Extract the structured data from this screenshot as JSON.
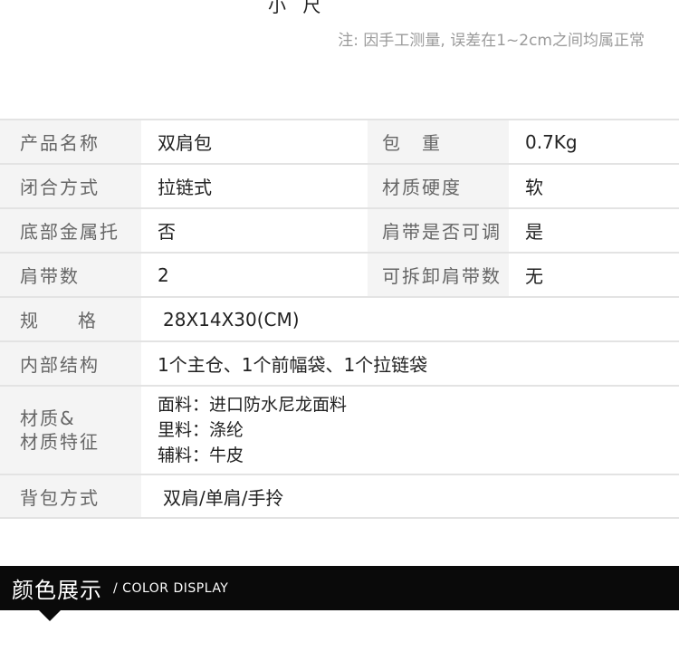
{
  "header": {
    "top_fragment": "小 尺",
    "note": "注: 因手工测量, 误差在1~2cm之间均属正常"
  },
  "specs": {
    "product_name_label": "产品名称",
    "product_name_value": "双肩包",
    "weight_label": "包　重",
    "weight_value": "0.7Kg",
    "closure_label": "闭合方式",
    "closure_value": "拉链式",
    "material_hardness_label": "材质硬度",
    "material_hardness_value": "软",
    "bottom_metal_label": "底部金属托",
    "bottom_metal_value": "否",
    "strap_adjustable_label": "肩带是否可调",
    "strap_adjustable_value": "是",
    "strap_count_label": "肩带数",
    "strap_count_value": "2",
    "detachable_strap_label": "可拆卸肩带数",
    "detachable_strap_value": "无",
    "size_label": "规　格",
    "size_value": "28X14X30(CM)",
    "inner_structure_label": "内部结构",
    "inner_structure_value": "1个主仓、1个前幅袋、1个拉链袋",
    "material_label_line1": "材质&",
    "material_label_line2": "材质特征",
    "material_lines": [
      "面料：进口防水尼龙面料",
      "里料：涤纶",
      "辅料：牛皮"
    ],
    "carry_label": "背包方式",
    "carry_value": "双肩/单肩/手拎"
  },
  "color_section": {
    "title_cn": "颜色展示",
    "title_en": "/ COLOR DISPLAY",
    "background": "#0a0a0a"
  }
}
